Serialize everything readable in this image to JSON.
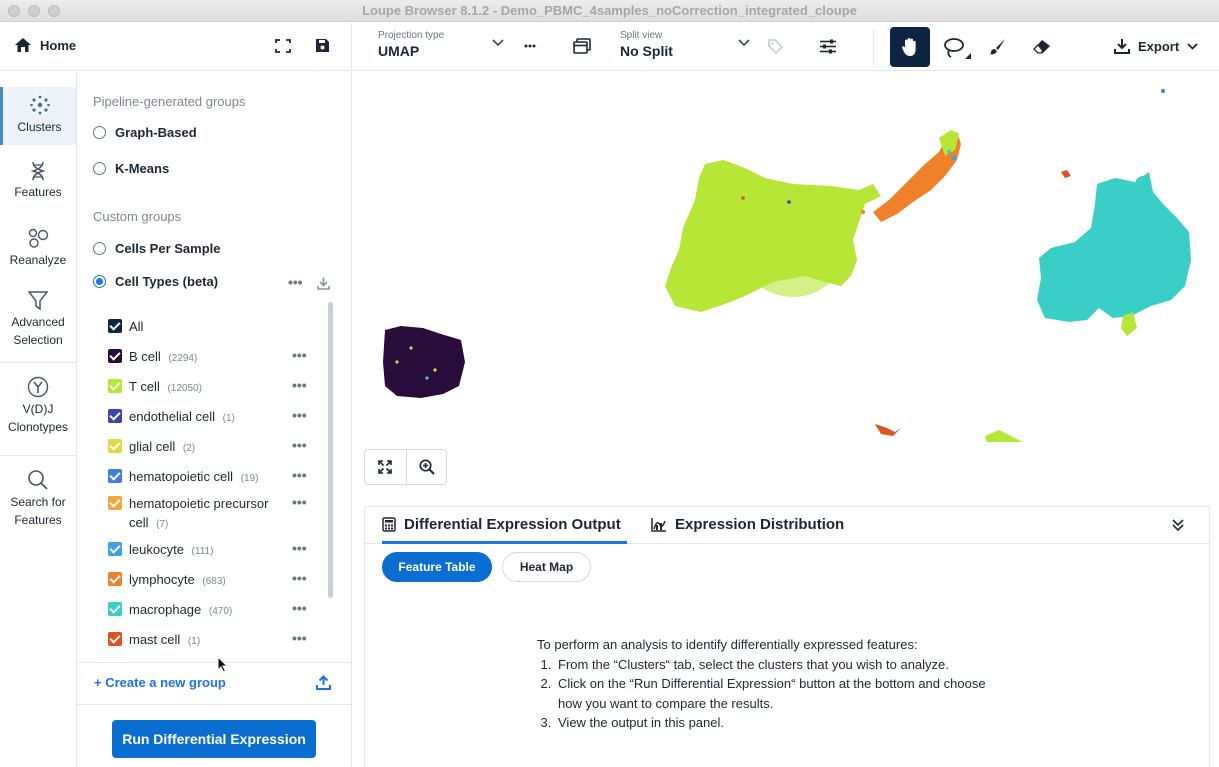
{
  "window": {
    "title": "Loupe Browser 8.1.2 - Demo_PBMC_4samples_noCorrection_integrated_cloupe"
  },
  "toolbar": {
    "home_label": "Home",
    "projection_label": "Projection type",
    "projection_value": "UMAP",
    "split_label": "Split view",
    "split_value": "No Split",
    "export_label": "Export"
  },
  "nav": {
    "clusters": "Clusters",
    "features": "Features",
    "reanalyze": "Reanalyze",
    "advanced_1": "Advanced",
    "advanced_2": "Selection",
    "vdj_1": "V(D)J",
    "vdj_2": "Clonotypes",
    "search_1": "Search for",
    "search_2": "Features"
  },
  "panel": {
    "pipeline_heading": "Pipeline-generated groups",
    "graph_based": "Graph-Based",
    "kmeans": "K-Means",
    "custom_heading": "Custom groups",
    "cells_per_sample": "Cells Per Sample",
    "cell_types": "Cell Types (beta)",
    "all_label": "All",
    "cells": [
      {
        "name": "B cell",
        "count": "(2294)",
        "color": "#2a0c3a"
      },
      {
        "name": "T cell",
        "count": "(12050)",
        "color": "#b6e636"
      },
      {
        "name": "endothelial cell",
        "count": "(1)",
        "color": "#3b46a8"
      },
      {
        "name": "glial cell",
        "count": "(2)",
        "color": "#e5d941"
      },
      {
        "name": "hematopoietic cell",
        "count": "(19)",
        "color": "#3f7ee0"
      },
      {
        "name": "hematopoietic precursor cell",
        "count": "(7)",
        "color": "#f0a93a"
      },
      {
        "name": "leukocyte",
        "count": "(111)",
        "color": "#3fa0e6"
      },
      {
        "name": "lymphocyte",
        "count": "(683)",
        "color": "#f0812a"
      },
      {
        "name": "macrophage",
        "count": "(470)",
        "color": "#39cfc6"
      },
      {
        "name": "mast cell",
        "count": "(1)",
        "color": "#e0521f"
      }
    ],
    "create_group": "+ Create a new group",
    "run_button": "Run Differential Expression"
  },
  "bottom": {
    "tab_de": "Differential Expression Output",
    "tab_dist": "Expression Distribution",
    "pill_feature": "Feature Table",
    "pill_heat": "Heat Map",
    "instr_intro": "To perform an analysis to identify differentially expressed features:",
    "instr_1": "From the “Clusters“ tab, select the clusters that you wish to analyze.",
    "instr_2a": "Click on the “Run Differential Expression“ button at the bottom and choose",
    "instr_2b": "how you want to compare the results.",
    "instr_3": "View the output in this panel."
  },
  "colors": {
    "accent": "#0a6ed1",
    "selected_tool": "#0d2540"
  }
}
